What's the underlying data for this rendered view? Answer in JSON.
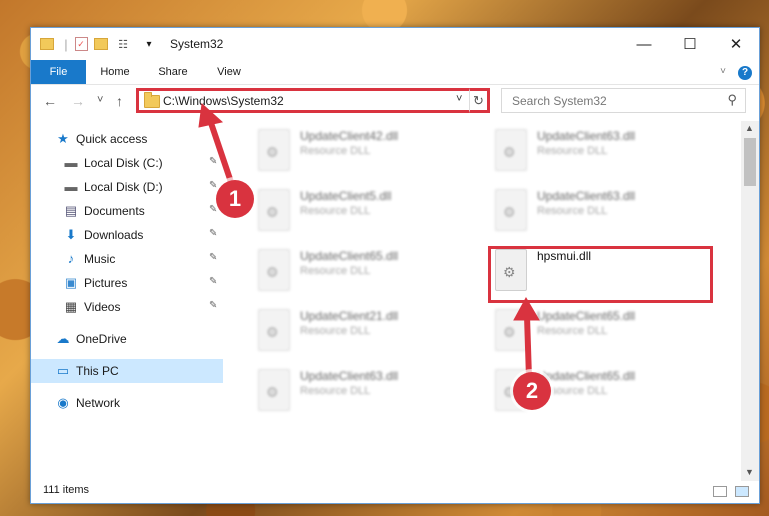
{
  "window": {
    "title": "System32",
    "controls": {
      "minimize": "—",
      "maximize": "☐",
      "close": "✕"
    }
  },
  "ribbon": {
    "tabs": [
      "File",
      "Home",
      "Share",
      "View"
    ],
    "collapse_icon": "chevron-down-icon",
    "help_icon": "?"
  },
  "nav": {
    "back": "←",
    "forward": "→",
    "recent": "˅",
    "up": "↑",
    "address": "C:\\Windows\\System32",
    "address_dropdown": "˅",
    "refresh": "↻",
    "search_placeholder": "Search System32"
  },
  "sidebar": {
    "items": [
      {
        "label": "Quick access",
        "icon": "★",
        "icon_name": "star-icon"
      },
      {
        "label": "Local Disk (C:)",
        "icon": "▬",
        "icon_name": "drive-icon",
        "pinned": true
      },
      {
        "label": "Local Disk (D:)",
        "icon": "▬",
        "icon_name": "drive-icon",
        "pinned": true
      },
      {
        "label": "Documents",
        "icon": "▤",
        "icon_name": "documents-icon",
        "pinned": true
      },
      {
        "label": "Downloads",
        "icon": "⬇",
        "icon_name": "download-icon",
        "pinned": true
      },
      {
        "label": "Music",
        "icon": "♪",
        "icon_name": "music-icon",
        "pinned": true
      },
      {
        "label": "Pictures",
        "icon": "▣",
        "icon_name": "pictures-icon",
        "pinned": true
      },
      {
        "label": "Videos",
        "icon": "▦",
        "icon_name": "videos-icon",
        "pinned": true
      },
      {
        "label": "OneDrive",
        "icon": "☁",
        "icon_name": "cloud-icon"
      },
      {
        "label": "This PC",
        "icon": "▭",
        "icon_name": "computer-icon",
        "selected": true
      },
      {
        "label": "Network",
        "icon": "◉",
        "icon_name": "network-icon"
      }
    ],
    "pin_icon": "📌"
  },
  "files": [
    {
      "name": "UpdateClient42.dll",
      "type": "Resource DLL"
    },
    {
      "name": "UpdateClient63.dll",
      "type": "Resource DLL"
    },
    {
      "name": "UpdateClient5.dll",
      "type": "Resource DLL"
    },
    {
      "name": "UpdateClient63.dll",
      "type": "Resource DLL"
    },
    {
      "name": "UpdateClient65.dll",
      "type": "Resource DLL"
    },
    {
      "name": "hpsmui.dll",
      "type": ""
    },
    {
      "name": "UpdateClient21.dll",
      "type": "Resource DLL"
    },
    {
      "name": "UpdateClient65.dll",
      "type": "Resource DLL"
    },
    {
      "name": "UpdateClient63.dll",
      "type": "Resource DLL"
    },
    {
      "name": "UpdateClient65.dll",
      "type": "Resource DLL"
    }
  ],
  "status": {
    "count": "111 items"
  },
  "markers": [
    "1",
    "2"
  ],
  "colors": {
    "accent": "#1979ca",
    "highlight": "#d9333f",
    "selected": "#cce8ff"
  }
}
